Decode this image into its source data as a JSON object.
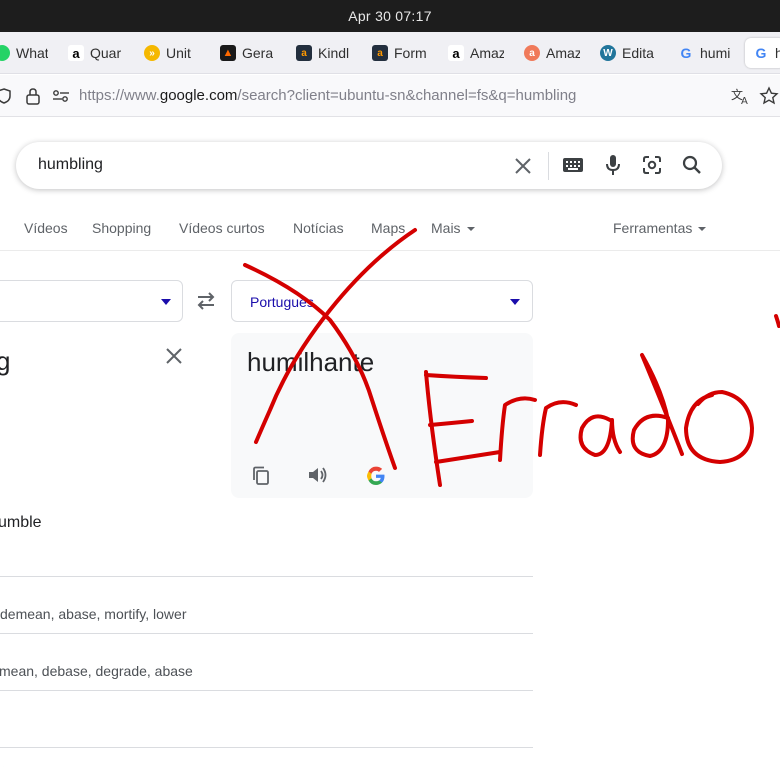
{
  "system": {
    "date": "Apr 30",
    "time": "07:17"
  },
  "tabs": [
    {
      "label": "What",
      "icon": "whatsapp-icon",
      "color": "#25d366"
    },
    {
      "label": "Quar",
      "icon": "amazon-icon",
      "color": "#ffffff"
    },
    {
      "label": "Unit",
      "icon": "unit-icon",
      "color": "#f5b800"
    },
    {
      "label": "Gera",
      "icon": "gera-icon",
      "color": "#1a1a1a"
    },
    {
      "label": "Kindl",
      "icon": "amazon-kindle-icon",
      "color": "#232f3e"
    },
    {
      "label": "Form",
      "icon": "amazon-form-icon",
      "color": "#232f3e"
    },
    {
      "label": "Amaz",
      "icon": "amazon-icon",
      "color": "#ffffff"
    },
    {
      "label": "Amaz",
      "icon": "amazon-red-icon",
      "color": "#f07a5a"
    },
    {
      "label": "Edita",
      "icon": "wordpress-icon",
      "color": "#21759b"
    },
    {
      "label": "humi",
      "icon": "google-icon",
      "color": "#ffffff"
    },
    {
      "label": "h",
      "icon": "google-icon",
      "color": "#ffffff"
    }
  ],
  "url": {
    "prefix": "https://www.",
    "domain": "google.com",
    "path": "/search?client=ubuntu-sn&channel=fs&q=humbling"
  },
  "search": {
    "query": "humbling"
  },
  "nav": {
    "videos": "Vídeos",
    "shopping": "Shopping",
    "short_videos": "Vídeos curtos",
    "news": "Notícias",
    "maps": "Maps",
    "more": "Mais",
    "tools": "Ferramentas"
  },
  "translate": {
    "source_text": "g",
    "target_language": "Português",
    "target_text": "humilhante"
  },
  "definitions": {
    "word": "umble",
    "synonyms_1": "demean, abase, mortify, lower",
    "synonyms_2": "mean, debase, degrade, abase"
  },
  "annotation": {
    "text": "Errado",
    "color": "#d40000"
  }
}
